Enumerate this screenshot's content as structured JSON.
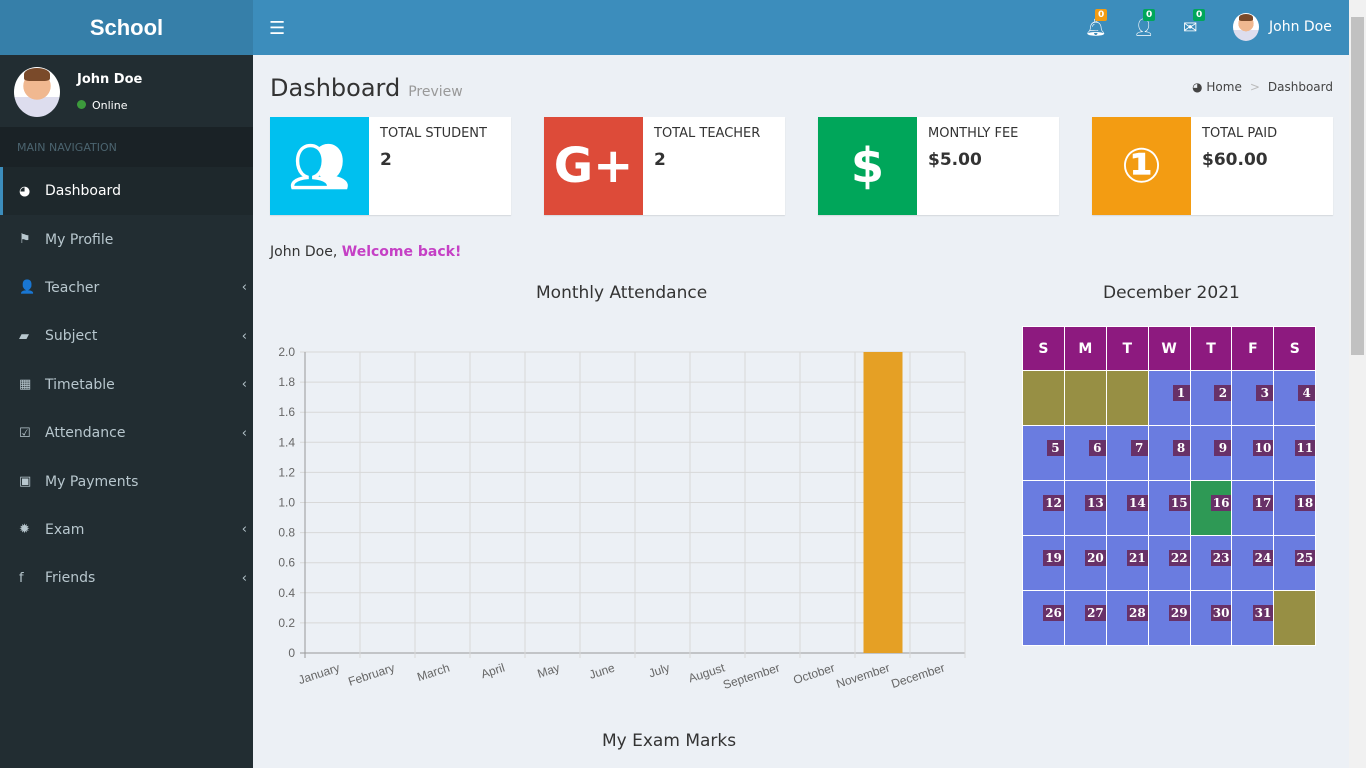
{
  "app": {
    "logo": "School"
  },
  "header": {
    "notifications": [
      {
        "icon": "bell-icon",
        "count": "0",
        "color": "#f39c12"
      },
      {
        "icon": "user-plus-icon",
        "count": "0",
        "color": "#00a65a"
      },
      {
        "icon": "envelope-icon",
        "count": "0",
        "color": "#00a65a"
      }
    ],
    "user": "John Doe"
  },
  "sidebar": {
    "user": "John Doe",
    "status": "Online",
    "section": "MAIN NAVIGATION",
    "items": [
      {
        "label": "Dashboard",
        "icon": "dashboard-icon",
        "sym": "◕"
      },
      {
        "label": "My Profile",
        "icon": "flag-icon",
        "sym": "⚑"
      },
      {
        "label": "Teacher",
        "icon": "user-icon",
        "sym": "👤"
      },
      {
        "label": "Subject",
        "icon": "book-icon",
        "sym": "▰"
      },
      {
        "label": "Timetable",
        "icon": "calendar-plus-icon",
        "sym": "▦"
      },
      {
        "label": "Attendance",
        "icon": "calendar-check-icon",
        "sym": "☑"
      },
      {
        "label": "My Payments",
        "icon": "money-icon",
        "sym": "▣"
      },
      {
        "label": "Exam",
        "icon": "gear-icon",
        "sym": "✹"
      },
      {
        "label": "Friends",
        "icon": "facebook-icon",
        "sym": "f"
      }
    ]
  },
  "page": {
    "title": "Dashboard",
    "subtitle": "Preview",
    "breadcrumb": [
      "Home",
      "Dashboard"
    ]
  },
  "boxes": [
    {
      "label": "Total Student",
      "value": "2",
      "color": "#00c0ef",
      "icon": "users-icon"
    },
    {
      "label": "Total Teacher",
      "value": "2",
      "color": "#dd4b39",
      "icon": "google-plus-icon"
    },
    {
      "label": "Monthly Fee",
      "value": "$5.00",
      "color": "#00a65a",
      "icon": "dollar-icon"
    },
    {
      "label": "Total Paid",
      "value": "$60.00",
      "color": "#f39c12",
      "icon": "money-bill-icon"
    }
  ],
  "welcome": {
    "name": "John Doe,",
    "msg": "Welcome back!"
  },
  "chart_data": {
    "type": "bar",
    "title": "Monthly Attendance",
    "categories": [
      "January",
      "February",
      "March",
      "April",
      "May",
      "June",
      "July",
      "August",
      "September",
      "October",
      "November",
      "December"
    ],
    "values": [
      0,
      0,
      0,
      0,
      0,
      0,
      0,
      0,
      0,
      0,
      2,
      0
    ],
    "yticks": [
      "0",
      "0.2",
      "0.4",
      "0.6",
      "0.8",
      "1.0",
      "1.2",
      "1.4",
      "1.6",
      "1.8",
      "2.0"
    ],
    "ylim": [
      0,
      2
    ],
    "grid": true,
    "bar_color": "#e5a025"
  },
  "calendar": {
    "title": "December 2021",
    "days": [
      "S",
      "M",
      "T",
      "W",
      "T",
      "F",
      "S"
    ],
    "start_offset": 3,
    "num_days": 31,
    "today": 16
  },
  "exam": {
    "title": "My Exam Marks"
  }
}
